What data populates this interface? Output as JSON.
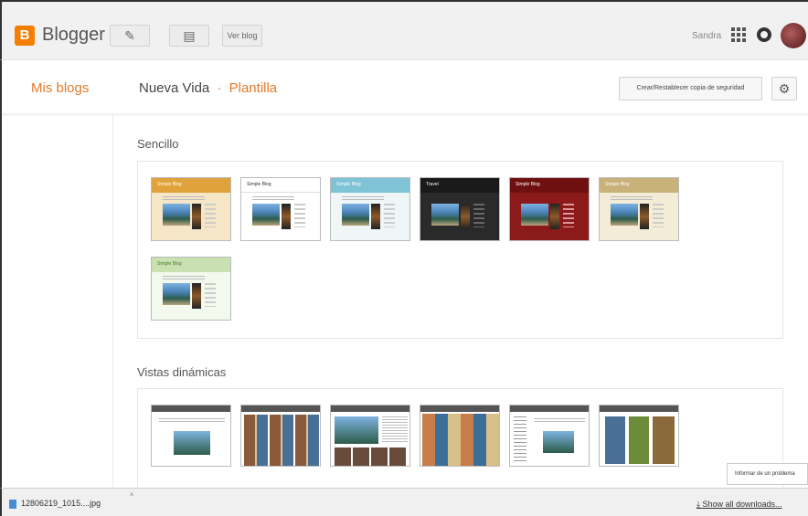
{
  "header": {
    "logo_letter": "B",
    "brand": "Blogger",
    "view_blog_label": "Ver blog",
    "user_name": "Sandra",
    "icons": [
      "pencil-icon",
      "pages-icon",
      "apps-icon",
      "notifications-icon",
      "avatar"
    ]
  },
  "subheader": {
    "my_blogs": "Mis blogs",
    "blog_name": "Nueva Vida",
    "separator": "·",
    "section": "Plantilla",
    "backup_button": "Crear/Restablecer copia de seguridad",
    "settings_icon": "gear-icon"
  },
  "sections": {
    "simple": {
      "title": "Sencillo",
      "thumb_labels": [
        "Simple Blog",
        "Simple Blog",
        "Simple Blog",
        "Travel",
        "Simple Blog",
        "Simple Blog",
        "Simple Blog"
      ]
    },
    "dynamic": {
      "title": "Vistas dinámicas"
    }
  },
  "downloads": {
    "file_name": "12806219_1015....jpg",
    "show_all": "Show all downloads..."
  },
  "report_popup": "Informar de un problema",
  "colors": {
    "accent": "#e27a29",
    "logo": "#f57d00"
  }
}
